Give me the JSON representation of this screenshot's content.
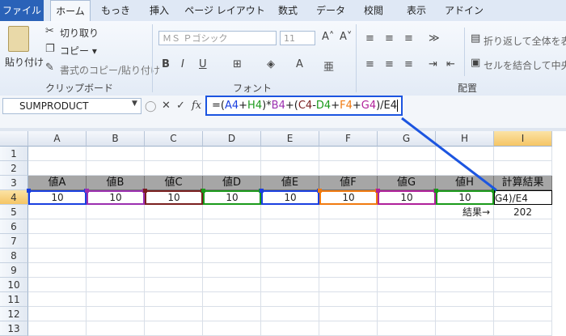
{
  "ribbon_tabs": [
    "ファイル",
    "ホーム",
    "もっき",
    "挿入",
    "ページ レイアウト",
    "数式",
    "データ",
    "校閲",
    "表示",
    "アドイン"
  ],
  "clipboard": {
    "paste_label": "貼り付け",
    "cut_label": "切り取り",
    "copy_label": "コピー ▾",
    "format_painter_label": "書式のコピー/貼り付け",
    "group_label": "クリップボード"
  },
  "font": {
    "name": "ＭＳ Ｐゴシック",
    "size": "11",
    "group_label": "フォント"
  },
  "alignment": {
    "wrap_label": "折り返して全体を表",
    "merge_label": "セルを結合して中央揃",
    "group_label": "配置"
  },
  "formula_bar": {
    "name_box": "SUMPRODUCT",
    "fx_label": "fx",
    "formula_parts": [
      {
        "text": "=(",
        "color": "#222222"
      },
      {
        "text": "A4",
        "color": "#1a3fe0"
      },
      {
        "text": "+",
        "color": "#222222"
      },
      {
        "text": "H4",
        "color": "#1a9a1a"
      },
      {
        "text": ")*",
        "color": "#222222"
      },
      {
        "text": "B4",
        "color": "#9b2fb0"
      },
      {
        "text": "+(",
        "color": "#222222"
      },
      {
        "text": "C4",
        "color": "#7a1f1f"
      },
      {
        "text": "-",
        "color": "#222222"
      },
      {
        "text": "D4",
        "color": "#1a9a1a"
      },
      {
        "text": "+",
        "color": "#222222"
      },
      {
        "text": "F4",
        "color": "#f07a10"
      },
      {
        "text": "+",
        "color": "#222222"
      },
      {
        "text": "G4",
        "color": "#b0209a"
      },
      {
        "text": ")/E4",
        "color": "#222222"
      }
    ]
  },
  "sheet": {
    "columns": [
      "A",
      "B",
      "C",
      "D",
      "E",
      "F",
      "G",
      "H",
      "I"
    ],
    "rows": [
      "1",
      "2",
      "3",
      "4",
      "5",
      "6",
      "7",
      "8",
      "9",
      "10",
      "11",
      "12",
      "13"
    ],
    "headers": [
      "値A",
      "値B",
      "値C",
      "値D",
      "値E",
      "値F",
      "値G",
      "値H",
      "計算結果"
    ],
    "values": [
      "10",
      "10",
      "10",
      "10",
      "10",
      "10",
      "10",
      "10"
    ],
    "editing_cell": "G4)/E4",
    "result_label": "結果→",
    "result_value": "202"
  },
  "colors": {
    "highlight_box": "#1c55e0",
    "header_fill": "#a6a6a6",
    "ref_colors": [
      "#1a3fe0",
      "#9b2fb0",
      "#7a1f1f",
      "#1a9a1a",
      "#1a3fe0",
      "#f07a10",
      "#b0209a",
      "#1a9a1a"
    ]
  }
}
